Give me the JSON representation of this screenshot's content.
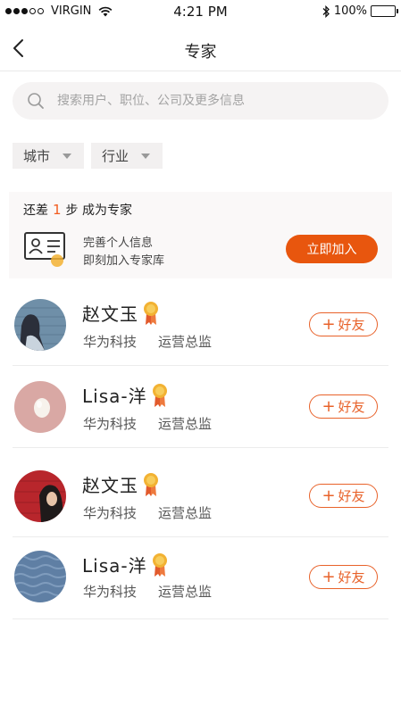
{
  "status_bar": {
    "carrier": "VIRGIN",
    "time": "4:21 PM",
    "battery": "100%",
    "signal_strength": 3,
    "signal_max": 5
  },
  "nav": {
    "title": "专家"
  },
  "search": {
    "placeholder": "搜索用户、职位、公司及更多信息"
  },
  "filters": [
    {
      "label": "城市"
    },
    {
      "label": "行业"
    }
  ],
  "promo": {
    "title_prefix": "还差",
    "steps": "1",
    "title_suffix": "步 成为专家",
    "line1": "完善个人信息",
    "line2": "即刻加入专家库",
    "button": "立即加入"
  },
  "experts": [
    {
      "name": "赵文玉",
      "company": "华为科技",
      "position": "运营总监",
      "add_label": "好友",
      "avatar": "avatar-blue-wall"
    },
    {
      "name": "Lisa-洋",
      "company": "华为科技",
      "position": "运营总监",
      "add_label": "好友",
      "avatar": "avatar-egg"
    },
    {
      "name": "赵文玉",
      "company": "华为科技",
      "position": "运营总监",
      "add_label": "好友",
      "avatar": "avatar-red-wall"
    },
    {
      "name": "Lisa-洋",
      "company": "华为科技",
      "position": "运营总监",
      "add_label": "好友",
      "avatar": "avatar-knit"
    }
  ],
  "colors": {
    "accent": "#e8560e",
    "medal_gold": "#f2b233",
    "medal_ribbon": "#e25a2c"
  }
}
